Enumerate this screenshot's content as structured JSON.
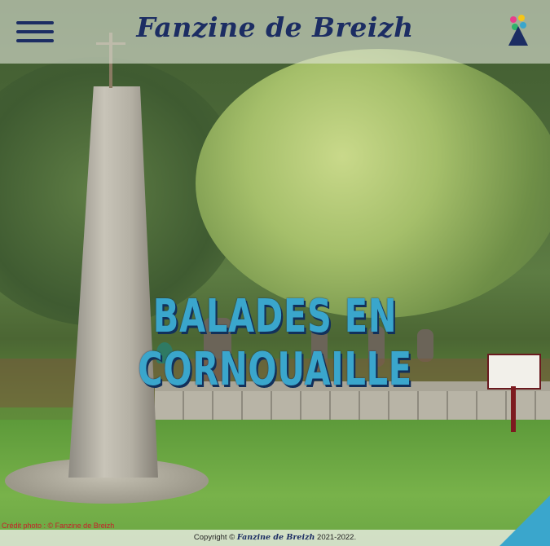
{
  "header": {
    "site_title": "Fanzine de Breizh",
    "menu_icon": "hamburger-menu-icon",
    "logo_icon": "breizh-logo-icon"
  },
  "hero": {
    "title": "BALADES EN CORNOUAILLE",
    "photo_credit": "Crédit photo : © Fanzine de Breizh"
  },
  "footer": {
    "copyright_prefix": "Copyright ©",
    "brand": "Fanzine de Breizh",
    "years": "2021-2022."
  },
  "colors": {
    "brand_navy": "#1c2d63",
    "accent_blue": "#3aa6cc",
    "credit_red": "#c81e2a"
  }
}
